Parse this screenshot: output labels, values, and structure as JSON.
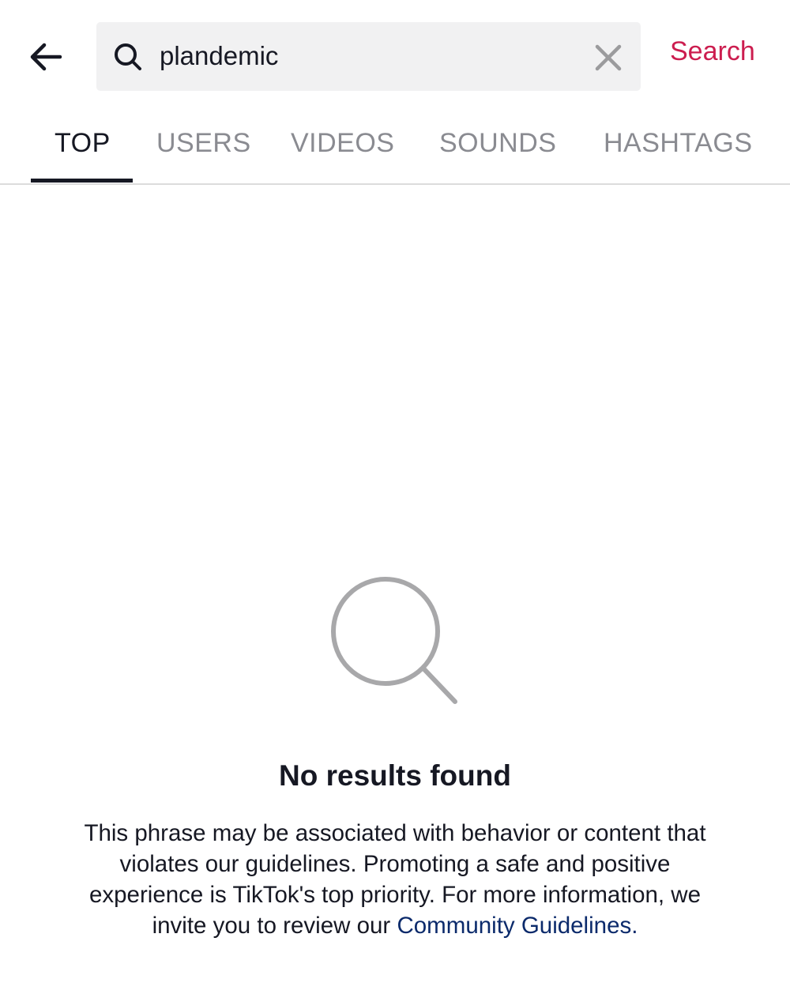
{
  "header": {
    "back_icon": "arrow-left-icon",
    "search": {
      "icon": "search-icon",
      "value": "plandemic",
      "clear_icon": "close-icon"
    },
    "submit_label": "Search"
  },
  "tabs": [
    {
      "label": "TOP",
      "active": true
    },
    {
      "label": "USERS",
      "active": false
    },
    {
      "label": "VIDEOS",
      "active": false
    },
    {
      "label": "SOUNDS",
      "active": false
    },
    {
      "label": "HASHTAGS",
      "active": false
    }
  ],
  "empty_state": {
    "icon": "magnifier-icon",
    "title": "No results found",
    "description_prefix": "This phrase may be associated with behavior or content that violates our guidelines. Promoting a safe and positive experience is TikTok's top priority. For more information, we invite you to review our ",
    "link_label": "Community Guidelines",
    "description_suffix": "."
  },
  "colors": {
    "accent": "#cc1d4f",
    "link": "#0b2a6b",
    "text_primary": "#161823",
    "text_secondary": "#8a8b91",
    "search_bg": "#f1f1f2",
    "icon_gray": "#a8a8aa"
  }
}
